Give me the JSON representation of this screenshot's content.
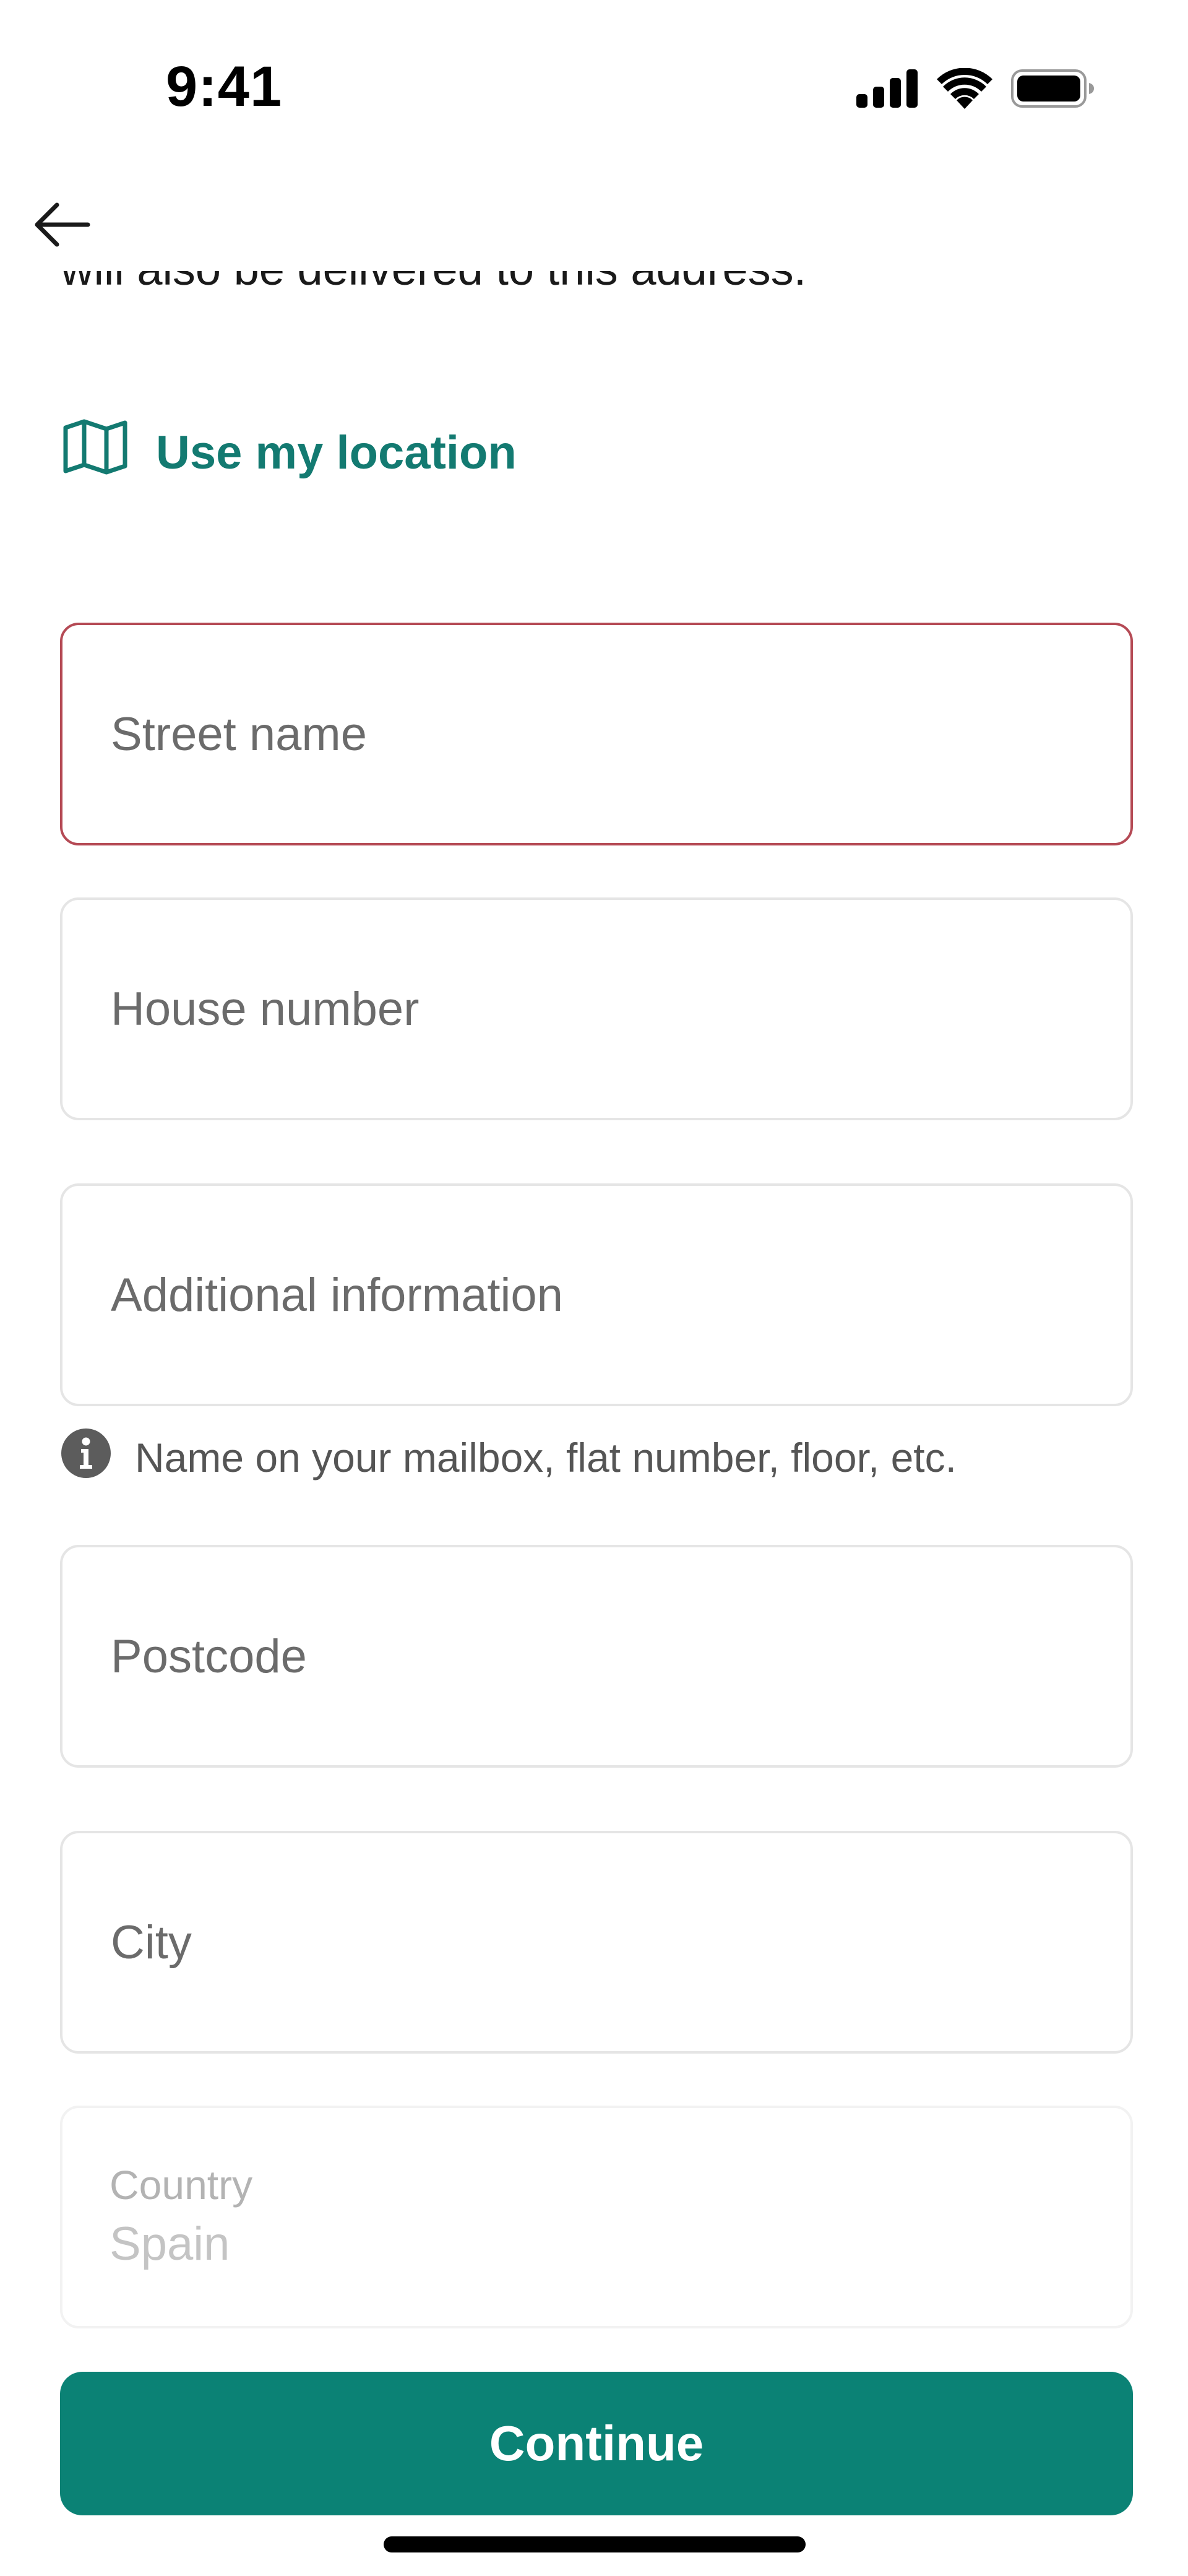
{
  "status_bar": {
    "time": "9:41",
    "icons": [
      "signal-icon",
      "wifi-icon",
      "battery-icon"
    ]
  },
  "header": {
    "back_icon": "arrow-left-icon"
  },
  "intro": {
    "text": "will also be delivered to this address."
  },
  "location": {
    "icon": "map-icon",
    "label": "Use my location"
  },
  "form": {
    "street": {
      "placeholder": "Street name",
      "value": ""
    },
    "house_number": {
      "placeholder": "House number",
      "value": ""
    },
    "additional_info": {
      "placeholder": "Additional information",
      "value": "",
      "helper_icon": "info-icon",
      "helper_text": "Name on your mailbox, flat number, floor, etc."
    },
    "postcode": {
      "placeholder": "Postcode",
      "value": ""
    },
    "city": {
      "placeholder": "City",
      "value": ""
    },
    "country": {
      "label": "Country",
      "value": "Spain"
    }
  },
  "actions": {
    "continue_label": "Continue"
  },
  "colors": {
    "accent": "#0b8275",
    "link": "#137a71",
    "error_border": "#b54a55",
    "field_border": "#e5e5e5"
  }
}
